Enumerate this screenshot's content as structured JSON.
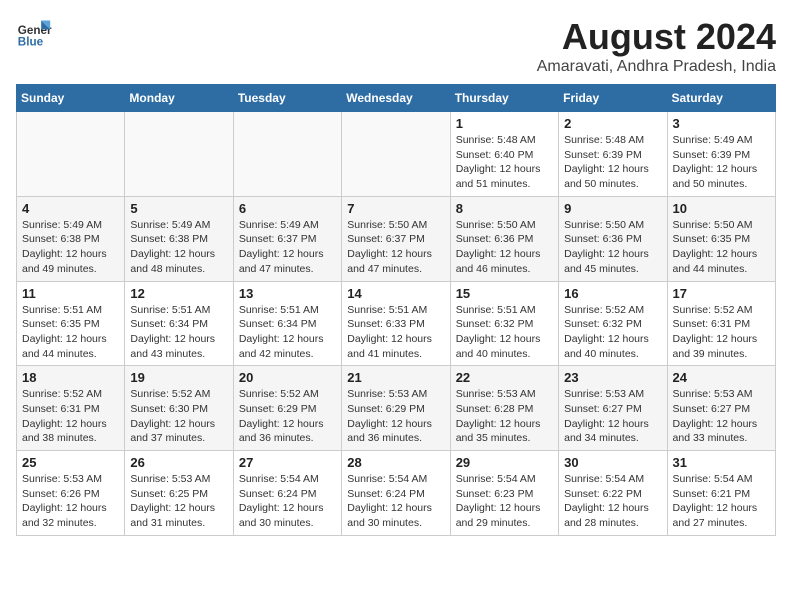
{
  "logo": {
    "line1": "General",
    "line2": "Blue"
  },
  "title": "August 2024",
  "subtitle": "Amaravati, Andhra Pradesh, India",
  "weekdays": [
    "Sunday",
    "Monday",
    "Tuesday",
    "Wednesday",
    "Thursday",
    "Friday",
    "Saturday"
  ],
  "weeks": [
    [
      {
        "day": "",
        "info": ""
      },
      {
        "day": "",
        "info": ""
      },
      {
        "day": "",
        "info": ""
      },
      {
        "day": "",
        "info": ""
      },
      {
        "day": "1",
        "info": "Sunrise: 5:48 AM\nSunset: 6:40 PM\nDaylight: 12 hours\nand 51 minutes."
      },
      {
        "day": "2",
        "info": "Sunrise: 5:48 AM\nSunset: 6:39 PM\nDaylight: 12 hours\nand 50 minutes."
      },
      {
        "day": "3",
        "info": "Sunrise: 5:49 AM\nSunset: 6:39 PM\nDaylight: 12 hours\nand 50 minutes."
      }
    ],
    [
      {
        "day": "4",
        "info": "Sunrise: 5:49 AM\nSunset: 6:38 PM\nDaylight: 12 hours\nand 49 minutes."
      },
      {
        "day": "5",
        "info": "Sunrise: 5:49 AM\nSunset: 6:38 PM\nDaylight: 12 hours\nand 48 minutes."
      },
      {
        "day": "6",
        "info": "Sunrise: 5:49 AM\nSunset: 6:37 PM\nDaylight: 12 hours\nand 47 minutes."
      },
      {
        "day": "7",
        "info": "Sunrise: 5:50 AM\nSunset: 6:37 PM\nDaylight: 12 hours\nand 47 minutes."
      },
      {
        "day": "8",
        "info": "Sunrise: 5:50 AM\nSunset: 6:36 PM\nDaylight: 12 hours\nand 46 minutes."
      },
      {
        "day": "9",
        "info": "Sunrise: 5:50 AM\nSunset: 6:36 PM\nDaylight: 12 hours\nand 45 minutes."
      },
      {
        "day": "10",
        "info": "Sunrise: 5:50 AM\nSunset: 6:35 PM\nDaylight: 12 hours\nand 44 minutes."
      }
    ],
    [
      {
        "day": "11",
        "info": "Sunrise: 5:51 AM\nSunset: 6:35 PM\nDaylight: 12 hours\nand 44 minutes."
      },
      {
        "day": "12",
        "info": "Sunrise: 5:51 AM\nSunset: 6:34 PM\nDaylight: 12 hours\nand 43 minutes."
      },
      {
        "day": "13",
        "info": "Sunrise: 5:51 AM\nSunset: 6:34 PM\nDaylight: 12 hours\nand 42 minutes."
      },
      {
        "day": "14",
        "info": "Sunrise: 5:51 AM\nSunset: 6:33 PM\nDaylight: 12 hours\nand 41 minutes."
      },
      {
        "day": "15",
        "info": "Sunrise: 5:51 AM\nSunset: 6:32 PM\nDaylight: 12 hours\nand 40 minutes."
      },
      {
        "day": "16",
        "info": "Sunrise: 5:52 AM\nSunset: 6:32 PM\nDaylight: 12 hours\nand 40 minutes."
      },
      {
        "day": "17",
        "info": "Sunrise: 5:52 AM\nSunset: 6:31 PM\nDaylight: 12 hours\nand 39 minutes."
      }
    ],
    [
      {
        "day": "18",
        "info": "Sunrise: 5:52 AM\nSunset: 6:31 PM\nDaylight: 12 hours\nand 38 minutes."
      },
      {
        "day": "19",
        "info": "Sunrise: 5:52 AM\nSunset: 6:30 PM\nDaylight: 12 hours\nand 37 minutes."
      },
      {
        "day": "20",
        "info": "Sunrise: 5:52 AM\nSunset: 6:29 PM\nDaylight: 12 hours\nand 36 minutes."
      },
      {
        "day": "21",
        "info": "Sunrise: 5:53 AM\nSunset: 6:29 PM\nDaylight: 12 hours\nand 36 minutes."
      },
      {
        "day": "22",
        "info": "Sunrise: 5:53 AM\nSunset: 6:28 PM\nDaylight: 12 hours\nand 35 minutes."
      },
      {
        "day": "23",
        "info": "Sunrise: 5:53 AM\nSunset: 6:27 PM\nDaylight: 12 hours\nand 34 minutes."
      },
      {
        "day": "24",
        "info": "Sunrise: 5:53 AM\nSunset: 6:27 PM\nDaylight: 12 hours\nand 33 minutes."
      }
    ],
    [
      {
        "day": "25",
        "info": "Sunrise: 5:53 AM\nSunset: 6:26 PM\nDaylight: 12 hours\nand 32 minutes."
      },
      {
        "day": "26",
        "info": "Sunrise: 5:53 AM\nSunset: 6:25 PM\nDaylight: 12 hours\nand 31 minutes."
      },
      {
        "day": "27",
        "info": "Sunrise: 5:54 AM\nSunset: 6:24 PM\nDaylight: 12 hours\nand 30 minutes."
      },
      {
        "day": "28",
        "info": "Sunrise: 5:54 AM\nSunset: 6:24 PM\nDaylight: 12 hours\nand 30 minutes."
      },
      {
        "day": "29",
        "info": "Sunrise: 5:54 AM\nSunset: 6:23 PM\nDaylight: 12 hours\nand 29 minutes."
      },
      {
        "day": "30",
        "info": "Sunrise: 5:54 AM\nSunset: 6:22 PM\nDaylight: 12 hours\nand 28 minutes."
      },
      {
        "day": "31",
        "info": "Sunrise: 5:54 AM\nSunset: 6:21 PM\nDaylight: 12 hours\nand 27 minutes."
      }
    ]
  ]
}
